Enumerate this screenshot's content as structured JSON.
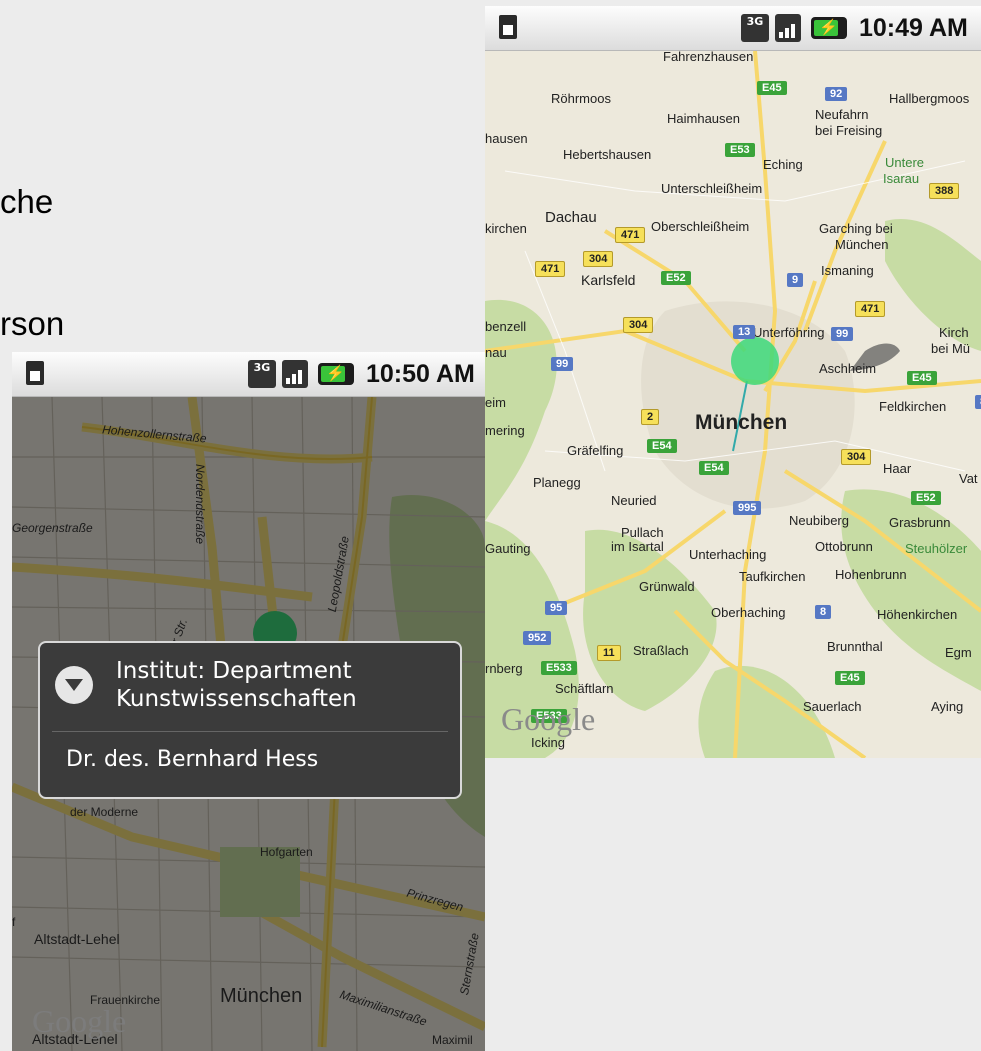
{
  "slide": {
    "line1": "che",
    "line2": "rson"
  },
  "phone_right": {
    "status_time": "10:49 AM",
    "status_network": "3G",
    "labels": {
      "m1": "Röhrmoos",
      "m2": "Haimhausen",
      "m3": "Neufahrn",
      "m4": "bei Freising",
      "m5": "Hallbergmoos",
      "m6": "Hebertshausen",
      "m7": "Eching",
      "m8": "Untere",
      "m9": "Isarau",
      "m10": "Unterschleißheim",
      "m11": "Dachau",
      "m12": "Oberschleißheim",
      "m13": "Garching bei",
      "m14": "München",
      "m15": "Karlsfeld",
      "m16": "Ismaning",
      "m17": "Unterföhring",
      "m18": "Aschheim",
      "m19": "Feldkirchen",
      "m20": "München",
      "m21": "Gräfelfing",
      "m22": "Planegg",
      "m23": "Haar",
      "m24": "Neuried",
      "m25": "Neubiberg",
      "m26": "Grasbrunn",
      "m27": "Pullach",
      "m28": "im Isartal",
      "m29": "Unterhaching",
      "m30": "Ottobrunn",
      "m31": "Gauting",
      "m32": "Steuhölzer",
      "m33": "Grünwald",
      "m34": "Taufkirchen",
      "m35": "Hohenbrunn",
      "m36": "Oberhaching",
      "m37": "Höhenkirchen",
      "m38": "Straßlach",
      "m39": "Brunnthal",
      "m40": "Schäftlarn",
      "m41": "Sauerlach",
      "m42": "Aying",
      "m43": "Icking",
      "m44": "Fahrenzhausen",
      "m45": "Kirch",
      "m46": "bei Mü",
      "m47": "Vat",
      "m48": "Egm",
      "m49": "hausen",
      "m50": "kirchen",
      "m51": "benzell",
      "m52": "nau",
      "m53": "eim",
      "m54": "mering",
      "m55": "rnberg"
    },
    "shields": {
      "s1": "E45",
      "s2": "92",
      "s3": "E53",
      "s4": "388",
      "s5": "471",
      "s6": "304",
      "s7": "471",
      "s8": "E52",
      "s9": "9",
      "s10": "471",
      "s11": "304",
      "s12": "99",
      "s13": "99",
      "s14": "E45",
      "s15": "2",
      "s16": "E54",
      "s17": "E54",
      "s18": "304",
      "s19": "E52",
      "s20": "995",
      "s21": "95",
      "s22": "8",
      "s23": "952",
      "s24": "11",
      "s25": "E533",
      "s26": "E45",
      "s27": "E533",
      "s28": "8",
      "s29": "13"
    },
    "logo": "Google"
  },
  "phone_left": {
    "status_time": "10:50 AM",
    "status_network": "3G",
    "streets": {
      "t1": "Hohenzollernstraße",
      "t2": "Nordendstraße",
      "t3": "Georgenstraße",
      "t4": "Leopoldstraße",
      "t5": "er Str.",
      "t6": "der Moderne",
      "t7": "Hofgarten",
      "t8": "Prinzregen",
      "t9": "Altstadt-Lehel",
      "t10": "Frauenkirche",
      "t11": "München",
      "t12": "Maximilianstraße",
      "t13": "Sternstraße",
      "t14": "Altstadt-Lehel",
      "t15": "Maximil",
      "t16": "f"
    },
    "popup": {
      "title_line1": "Institut: Department",
      "title_line2": "Kunstwissenschaften",
      "person": "Dr. des. Bernhard Hess"
    },
    "logo": "Google"
  },
  "colors": {
    "map_bg": "#ede9dc",
    "green_area": "#c7dca4",
    "road_yellow": "#f7d76b",
    "pin": "#3dd97a"
  }
}
